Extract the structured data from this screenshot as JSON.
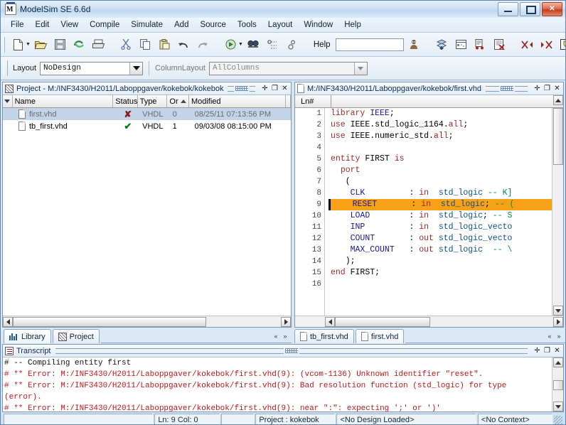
{
  "window": {
    "title": "ModelSim SE 6.6d",
    "app_icon": "modelsim-icon",
    "minimize": "minimize-icon",
    "maximize": "maximize-icon",
    "close": "close-icon"
  },
  "menu": {
    "items": [
      "File",
      "Edit",
      "View",
      "Compile",
      "Simulate",
      "Add",
      "Source",
      "Tools",
      "Layout",
      "Window",
      "Help"
    ]
  },
  "toolbar": {
    "groups": [
      {
        "buttons": [
          "new-file-icon",
          "open-folder-icon",
          "save-icon",
          "reload-icon",
          "print-icon"
        ]
      },
      {
        "buttons": [
          "cut-icon",
          "copy-icon",
          "paste-icon",
          "undo-icon",
          "redo-icon"
        ]
      },
      {
        "buttons": [
          "compile-icon",
          "find-icon",
          "find-next-icon",
          "find-prev-icon"
        ]
      }
    ],
    "help_label": "Help",
    "help_value": "",
    "help_placeholder": "",
    "help_search_icon": "help-search-icon",
    "group2": [
      "compile-all-icon",
      "simulate-icon",
      "compile-order-icon",
      "compile-cancel-icon"
    ],
    "group3": [
      "break-left-icon",
      "break-right-icon",
      "new-source-icon",
      "source-doc-icon",
      "stop-icon"
    ]
  },
  "layout_bar": {
    "layout_label": "Layout",
    "layout_value": "NoDesign",
    "column_label": "ColumnLayout",
    "column_value": "AllColumns"
  },
  "project_pane": {
    "icon": "project-icon",
    "title": "Project - M:/INF3430/H2011/Laboppgaver/kokebok/kokebok",
    "buttons": [
      "undock-icon",
      "maximize-pane-icon",
      "close-pane-icon"
    ],
    "columns": [
      "Name",
      "Status",
      "Type",
      "Or",
      "Modified",
      ""
    ],
    "rows": [
      {
        "name": "first.vhd",
        "status": "error",
        "type": "VHDL",
        "order": "0",
        "modified": "08/25/11 07:13:56 PM",
        "selected": true,
        "icon": "vhdl-file-icon"
      },
      {
        "name": "tb_first.vhd",
        "status": "ok",
        "type": "VHDL",
        "order": "1",
        "modified": "09/03/08 08:15:00 PM",
        "selected": false,
        "icon": "vhdl-file-icon"
      }
    ],
    "tabs": [
      {
        "label": "Library",
        "icon": "library-icon",
        "active": false
      },
      {
        "label": "Project",
        "icon": "project-icon",
        "active": true
      }
    ]
  },
  "source_pane": {
    "icon": "vhdl-file-icon",
    "title": "M:/INF3430/H2011/Laboppgaver/kokebok/first.vhd",
    "buttons": [
      "undock-icon",
      "maximize-pane-icon",
      "close-pane-icon"
    ],
    "gutter_header": "Ln#",
    "lines": [
      {
        "n": "1",
        "highlight": false,
        "tokens": [
          {
            "t": "library",
            "c": "kw"
          },
          {
            "t": " ",
            "c": "pl"
          },
          {
            "t": "IEEE",
            "c": "id"
          },
          {
            "t": ";",
            "c": "pl"
          }
        ]
      },
      {
        "n": "2",
        "highlight": false,
        "tokens": [
          {
            "t": "use",
            "c": "kw"
          },
          {
            "t": " IEEE.std_logic_1164.",
            "c": "pl"
          },
          {
            "t": "all",
            "c": "kw"
          },
          {
            "t": ";",
            "c": "pl"
          }
        ]
      },
      {
        "n": "3",
        "highlight": false,
        "tokens": [
          {
            "t": "use",
            "c": "kw"
          },
          {
            "t": " IEEE.numeric_std.",
            "c": "pl"
          },
          {
            "t": "all",
            "c": "kw"
          },
          {
            "t": ";",
            "c": "pl"
          }
        ]
      },
      {
        "n": "4",
        "highlight": false,
        "tokens": []
      },
      {
        "n": "5",
        "highlight": false,
        "tokens": [
          {
            "t": "entity",
            "c": "kw"
          },
          {
            "t": " FIRST ",
            "c": "pl"
          },
          {
            "t": "is",
            "c": "kw"
          }
        ]
      },
      {
        "n": "6",
        "highlight": false,
        "tokens": [
          {
            "t": "  ",
            "c": "pl"
          },
          {
            "t": "port",
            "c": "kw"
          }
        ]
      },
      {
        "n": "7",
        "highlight": false,
        "tokens": [
          {
            "t": "   (",
            "c": "pl"
          }
        ]
      },
      {
        "n": "8",
        "highlight": false,
        "tokens": [
          {
            "t": "    ",
            "c": "pl"
          },
          {
            "t": "CLK",
            "c": "id"
          },
          {
            "t": "         : ",
            "c": "pl"
          },
          {
            "t": "in",
            "c": "kw"
          },
          {
            "t": "  ",
            "c": "pl"
          },
          {
            "t": "std_logic",
            "c": "typ"
          },
          {
            "t": " ",
            "c": "pl"
          },
          {
            "t": "-- K]",
            "c": "cmt"
          }
        ]
      },
      {
        "n": "9",
        "highlight": true,
        "tokens": [
          {
            "t": "    ",
            "c": "pl"
          },
          {
            "t": "RESET",
            "c": "id"
          },
          {
            "t": "       : ",
            "c": "pl"
          },
          {
            "t": "in",
            "c": "kw"
          },
          {
            "t": "  ",
            "c": "pl"
          },
          {
            "t": "std_logic",
            "c": "typ"
          },
          {
            "t": "; ",
            "c": "pl"
          },
          {
            "t": "-- (",
            "c": "cmt"
          }
        ]
      },
      {
        "n": "10",
        "highlight": false,
        "tokens": [
          {
            "t": "    ",
            "c": "pl"
          },
          {
            "t": "LOAD",
            "c": "id"
          },
          {
            "t": "        : ",
            "c": "pl"
          },
          {
            "t": "in",
            "c": "kw"
          },
          {
            "t": "  ",
            "c": "pl"
          },
          {
            "t": "std_logic",
            "c": "typ"
          },
          {
            "t": "; ",
            "c": "pl"
          },
          {
            "t": "-- S",
            "c": "cmt"
          }
        ]
      },
      {
        "n": "11",
        "highlight": false,
        "tokens": [
          {
            "t": "    ",
            "c": "pl"
          },
          {
            "t": "INP",
            "c": "id"
          },
          {
            "t": "         : ",
            "c": "pl"
          },
          {
            "t": "in",
            "c": "kw"
          },
          {
            "t": "  ",
            "c": "pl"
          },
          {
            "t": "std_logic_vecto",
            "c": "typ"
          }
        ]
      },
      {
        "n": "12",
        "highlight": false,
        "tokens": [
          {
            "t": "    ",
            "c": "pl"
          },
          {
            "t": "COUNT",
            "c": "id"
          },
          {
            "t": "       : ",
            "c": "pl"
          },
          {
            "t": "out",
            "c": "kw"
          },
          {
            "t": " ",
            "c": "pl"
          },
          {
            "t": "std_logic_vecto",
            "c": "typ"
          }
        ]
      },
      {
        "n": "13",
        "highlight": false,
        "tokens": [
          {
            "t": "    ",
            "c": "pl"
          },
          {
            "t": "MAX_COUNT",
            "c": "id"
          },
          {
            "t": "   : ",
            "c": "pl"
          },
          {
            "t": "out",
            "c": "kw"
          },
          {
            "t": " ",
            "c": "pl"
          },
          {
            "t": "std_logic",
            "c": "typ"
          },
          {
            "t": "  ",
            "c": "pl"
          },
          {
            "t": "-- \\",
            "c": "cmt"
          }
        ]
      },
      {
        "n": "14",
        "highlight": false,
        "tokens": [
          {
            "t": "   );",
            "c": "pl"
          }
        ]
      },
      {
        "n": "15",
        "highlight": false,
        "tokens": [
          {
            "t": "end",
            "c": "kw"
          },
          {
            "t": " FIRST;",
            "c": "pl"
          }
        ]
      },
      {
        "n": "16",
        "highlight": false,
        "tokens": []
      }
    ],
    "tabs": [
      {
        "label": "tb_first.vhd",
        "icon": "vhdl-file-icon",
        "active": false
      },
      {
        "label": "first.vhd",
        "icon": "vhdl-file-icon",
        "active": true
      }
    ]
  },
  "transcript": {
    "icon": "transcript-icon",
    "title": "Transcript",
    "buttons": [
      "undock-icon",
      "maximize-pane-icon",
      "close-pane-icon"
    ],
    "lines": [
      {
        "text": "# -- Compiling entity first",
        "error": false
      },
      {
        "text": "# ** Error: M:/INF3430/H2011/Laboppgaver/kokebok/first.vhd(9): (vcom-1136) Unknown identifier \"reset\".",
        "error": true
      },
      {
        "text": "# ** Error: M:/INF3430/H2011/Laboppgaver/kokebok/first.vhd(9): Bad resolution function (std_logic) for type",
        "error": true
      },
      {
        "text": "(error).",
        "error": true
      },
      {
        "text": "# ** Error: M:/INF3430/H2011/Laboppgaver/kokebok/first.vhd(9): near \":\": expecting ';' or ')'",
        "error": true
      }
    ]
  },
  "statusbar": {
    "message": "",
    "position": "Ln:   9  Col: 0",
    "spacer": "",
    "project": "Project : kokebok",
    "design": "<No Design Loaded>",
    "context": "<No Context>"
  }
}
